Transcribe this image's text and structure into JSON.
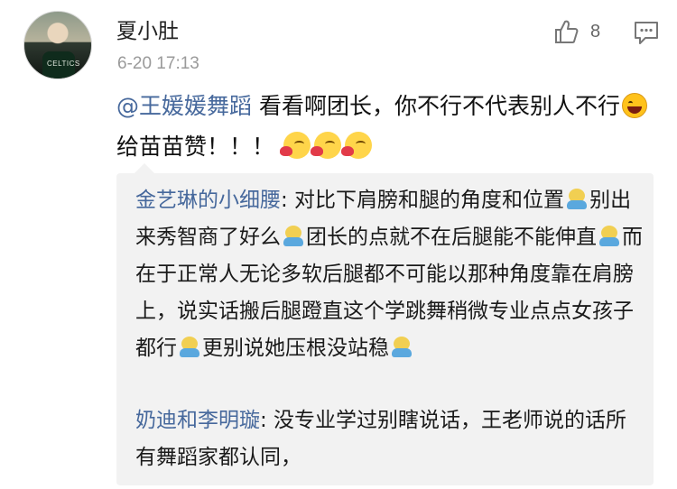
{
  "comment": {
    "username": "夏小肚",
    "timestamp": "6-20 17:13",
    "likes": "8",
    "avatar_jersey_text": "CELTICS",
    "content": {
      "mention": "@王媛媛舞蹈",
      "text_1": " 看看啊团长，你不行不代表别人不行",
      "text_2": " 给苗苗赞！！！"
    },
    "icons": {
      "like": "thumbs-up-icon",
      "reply": "comment-icon",
      "laugh": "laugh-emoji-icon",
      "cheer": "cheer-emoji-icon",
      "doge": "doge-emoji-icon"
    }
  },
  "quoted_replies": [
    {
      "author": "金艺琳的小细腰",
      "text_1": ": 对比下肩膀和腿的角度和位置",
      "text_2": "别出来秀智商了好么",
      "text_3": "团长的点就不在后腿能不能伸直",
      "text_4": "而在于正常人无论多软后腿都不可能以那种角度靠在肩膀上，说实话搬后腿蹬直这个学跳舞稍微专业点点女孩子都行",
      "text_5": "更别说她压根没站稳"
    },
    {
      "author": "奶迪和李明璇",
      "text": ": 没专业学过别瞎说话，王老师说的话所有舞蹈家都认同，"
    }
  ],
  "colors": {
    "link": "#46689c",
    "meta": "#9a9a9a",
    "quote_bg": "#f2f2f2"
  }
}
